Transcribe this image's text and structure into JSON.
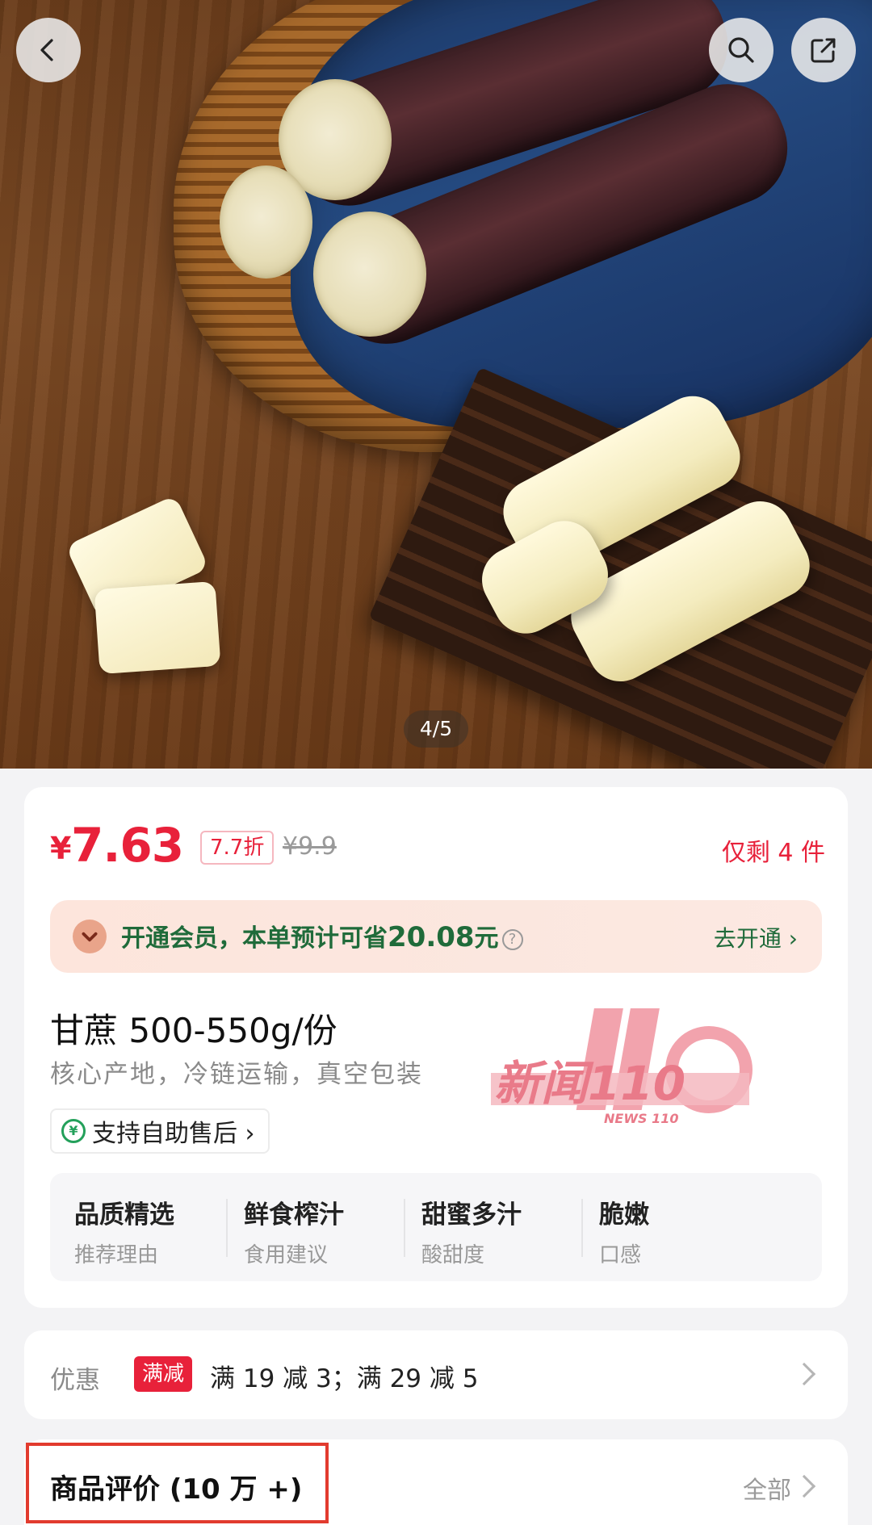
{
  "gallery": {
    "counter": "4/5"
  },
  "nav": {
    "back_icon": "chevron-left-icon",
    "search_icon": "search-icon",
    "share_icon": "share-icon"
  },
  "price": {
    "symbol": "¥",
    "current": "7.63",
    "discount": "7.7折",
    "original": "¥9.9",
    "stock": "仅剩 4 件",
    "accent_color": "#e8213a"
  },
  "member": {
    "text": "开通会员，本单预计可省",
    "amount": "20.08",
    "unit": "元",
    "help": "?",
    "cta": "去开通 ›"
  },
  "product": {
    "title": "甘蔗 500-550g/份",
    "subtitle": "核心产地，冷链运输，真空包装",
    "after_sale": "支持自助售后 ›",
    "after_sale_badge": "¥"
  },
  "watermark": {
    "text": "新闻110",
    "sub": "NEWS 110"
  },
  "features": [
    {
      "main": "品质精选",
      "sub": "推荐理由"
    },
    {
      "main": "鲜食榨汁",
      "sub": "食用建议"
    },
    {
      "main": "甜蜜多汁",
      "sub": "酸甜度"
    },
    {
      "main": "脆嫩",
      "sub": "口感"
    }
  ],
  "promo": {
    "label": "优惠",
    "tag": "满减",
    "text": "满 19 减 3；满 29 减 5"
  },
  "review": {
    "title": "商品评价 (10 万 +)",
    "all": "全部"
  }
}
